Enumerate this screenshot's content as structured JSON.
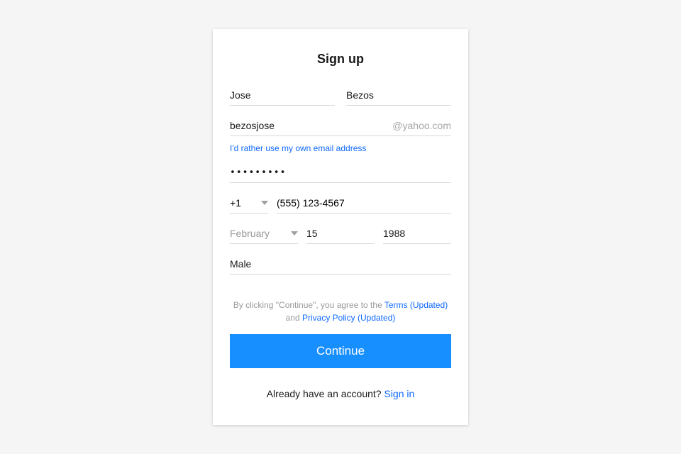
{
  "title": "Sign up",
  "name": {
    "first": "Jose",
    "last": "Bezos"
  },
  "email": {
    "local": "bezosjose",
    "domain_suffix": "@yahoo.com"
  },
  "own_email_link": "I'd rather use my own email address",
  "password": {
    "masked": "•••••••••"
  },
  "phone": {
    "country_code": "+1",
    "number": "(555) 123-4567"
  },
  "birth": {
    "month_placeholder": "February",
    "day": "15",
    "year": "1988"
  },
  "gender": "Male",
  "terms": {
    "prefix": "By clicking \"Continue\", you agree to the ",
    "link1": "Terms (Updated)",
    "mid": " and ",
    "link2": "Privacy Policy (Updated)"
  },
  "continue_label": "Continue",
  "signin": {
    "prompt": "Already have an account? ",
    "link": "Sign in"
  }
}
